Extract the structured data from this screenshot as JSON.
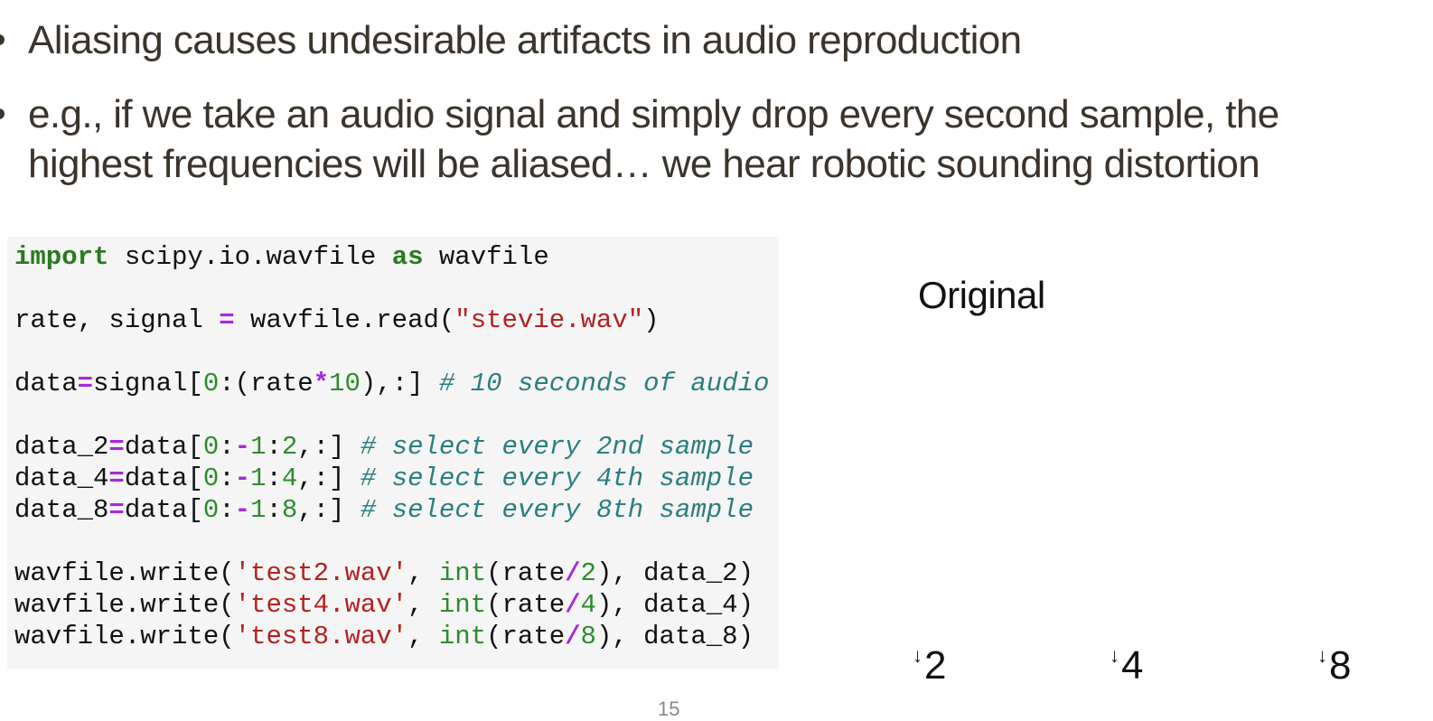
{
  "bullets": [
    "Aliasing causes undesirable artifacts in audio reproduction",
    "e.g., if we take an audio signal and simply drop every second sample, the",
    "highest frequencies will be aliased… we hear robotic sounding distortion"
  ],
  "code": {
    "line1": {
      "import": "import",
      "module": " scipy.io.wavfile ",
      "as": "as",
      "alias": " wavfile"
    },
    "line2": {
      "lhs": "rate, signal ",
      "eq": "=",
      "call": " wavfile.read(",
      "str": "\"stevie.wav\"",
      "close": ")"
    },
    "line3": {
      "var": "data",
      "eq": "=",
      "a": "signal[",
      "n0": "0",
      "b": ":(rate",
      "mul": "*",
      "n10": "10",
      "c": "),:] ",
      "comment": "# 10 seconds of audio"
    },
    "line4": {
      "var": "data_2",
      "eq": "=",
      "a": "data[",
      "n0": "0",
      "c1": ":",
      "minus": "-",
      "n1": "1",
      "c2": ":",
      "step": "2",
      "rest": ",:] ",
      "comment": "# select every 2nd sample"
    },
    "line5": {
      "var": "data_4",
      "eq": "=",
      "a": "data[",
      "n0": "0",
      "c1": ":",
      "minus": "-",
      "n1": "1",
      "c2": ":",
      "step": "4",
      "rest": ",:] ",
      "comment": "# select every 4th sample"
    },
    "line6": {
      "var": "data_8",
      "eq": "=",
      "a": "data[",
      "n0": "0",
      "c1": ":",
      "minus": "-",
      "n1": "1",
      "c2": ":",
      "step": "8",
      "rest": ",:] ",
      "comment": "# select every 8th sample"
    },
    "line7": {
      "a": "wavfile.write(",
      "str": "'test2.wav'",
      "b": ", ",
      "int": "int",
      "c": "(rate",
      "div": "/",
      "n": "2",
      "d": "), data_2)"
    },
    "line8": {
      "a": "wavfile.write(",
      "str": "'test4.wav'",
      "b": ", ",
      "int": "int",
      "c": "(rate",
      "div": "/",
      "n": "4",
      "d": "), data_4)"
    },
    "line9": {
      "a": "wavfile.write(",
      "str": "'test8.wav'",
      "b": ", ",
      "int": "int",
      "c": "(rate",
      "div": "/",
      "n": "8",
      "d": "), data_8)"
    }
  },
  "audio": {
    "original_label": "Original",
    "downsample_arrow": "↓",
    "downsample_labels": [
      "2",
      "4",
      "8"
    ]
  },
  "page_number": "15",
  "colors": {
    "keyword": "#2a7a1f",
    "operator": "#a629dc",
    "number": "#2e8b2e",
    "string": "#b22222",
    "comment": "#2b7e7e",
    "code_background": "#f5f5f5",
    "bullet_text": "#3b342c"
  }
}
